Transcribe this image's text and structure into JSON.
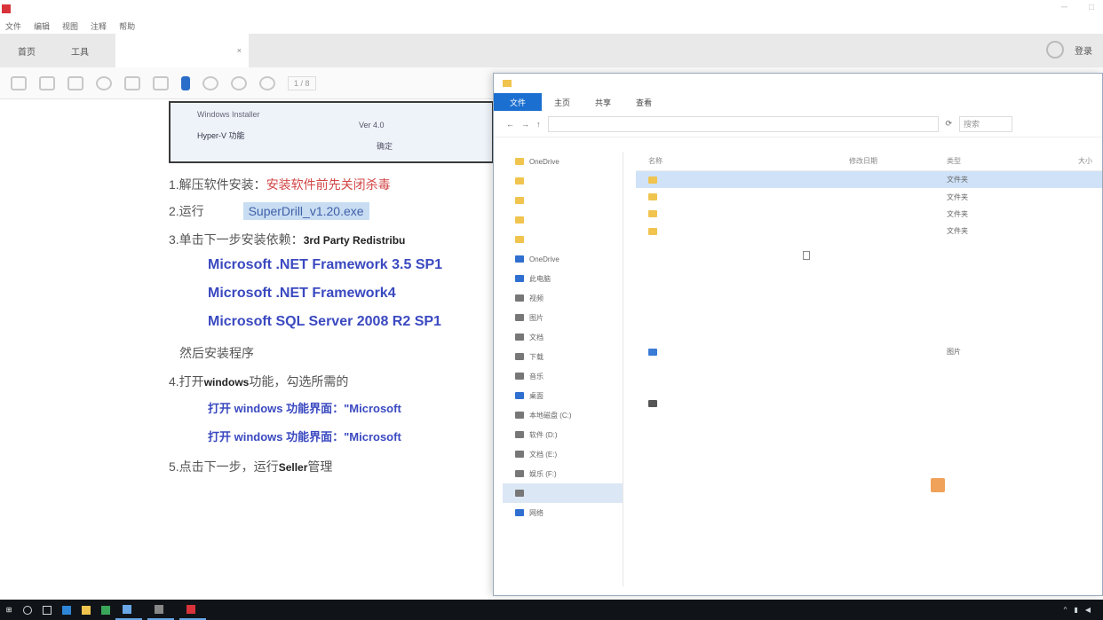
{
  "window": {
    "title": "",
    "menu": [
      "文件",
      "编辑",
      "视图",
      "注释",
      "帮助"
    ],
    "controls": [
      "─",
      "□"
    ]
  },
  "tabs": {
    "home": "首页",
    "tools": "工具",
    "document_tab": "",
    "close": "×",
    "login": "登录"
  },
  "toolbar": {
    "page_field": "1 / 8"
  },
  "document": {
    "screenshot": {
      "label1": "Windows Installer",
      "label2": "Hyper-V 功能",
      "value1": "Ver 4.0",
      "value2": "确定"
    },
    "line1_prefix": "1.解压软件安装：",
    "line1_red": "安装软件前先关闭杀毒",
    "line2_prefix": "2.运行",
    "line2_highlight": "SuperDrill_v1.20.exe",
    "line3_prefix": "3.单击下一步安装依赖：",
    "line3_black": "3rd Party Redistribu",
    "link1": "Microsoft .NET Framework 3.5 SP1",
    "link2": "Microsoft .NET Framework4",
    "link3": "Microsoft SQL Server 2008 R2 SP1",
    "line4": "然后安装程序",
    "line5_prefix": "4.打开",
    "line5_black": "windows",
    "line5_suffix": "功能，勾选所需的",
    "link4": "打开 windows 功能界面：\"Microsoft",
    "link5": "打开 windows 功能界面：\"Microsoft",
    "line6_prefix": "5.点击下一步，运行",
    "line6_black": "Seller",
    "line6_suffix": "管理"
  },
  "explorer": {
    "title": "",
    "ribbon": {
      "file": "文件",
      "tabs": [
        "主页",
        "共享",
        "查看"
      ]
    },
    "address": "",
    "search_placeholder": "搜索",
    "nav": [
      {
        "label": "OneDrive",
        "icon": "folder"
      },
      {
        "label": "",
        "icon": "folder"
      },
      {
        "label": "",
        "icon": "folder"
      },
      {
        "label": "",
        "icon": "folder"
      },
      {
        "label": "",
        "icon": "folder"
      },
      {
        "label": "OneDrive",
        "icon": "cloud"
      },
      {
        "label": "此电脑",
        "icon": "pc"
      },
      {
        "label": "视频",
        "icon": "folder"
      },
      {
        "label": "图片",
        "icon": "folder"
      },
      {
        "label": "文档",
        "icon": "folder"
      },
      {
        "label": "下载",
        "icon": "folder"
      },
      {
        "label": "音乐",
        "icon": "folder"
      },
      {
        "label": "桌面",
        "icon": "folder"
      },
      {
        "label": "本地磁盘 (C:)",
        "icon": "drive"
      },
      {
        "label": "软件 (D:)",
        "icon": "drive"
      },
      {
        "label": "文档 (E:)",
        "icon": "drive"
      },
      {
        "label": "娱乐 (F:)",
        "icon": "drive"
      },
      {
        "label": "",
        "icon": "drive"
      },
      {
        "label": "网络",
        "icon": "network"
      }
    ],
    "columns": [
      "名称",
      "修改日期",
      "类型",
      "大小"
    ],
    "files": [
      {
        "name": "",
        "date": "",
        "type": "文件夹",
        "size": "",
        "icon": "folder"
      },
      {
        "name": "",
        "date": "",
        "type": "文件夹",
        "size": "",
        "icon": "folder"
      },
      {
        "name": "",
        "date": "",
        "type": "文件夹",
        "size": "",
        "icon": "folder"
      },
      {
        "name": "",
        "date": "",
        "type": "文件夹",
        "size": "",
        "icon": "folder"
      },
      {
        "name": "",
        "date": "",
        "type": "",
        "size": "",
        "icon": "doc"
      },
      {
        "name": "",
        "date": "",
        "type": "",
        "size": "",
        "icon": "doc"
      },
      {
        "name": "",
        "date": "",
        "type": "",
        "size": "",
        "icon": "doc"
      },
      {
        "name": "",
        "date": "",
        "type": "",
        "size": "",
        "icon": "doc"
      },
      {
        "name": "",
        "date": "",
        "type": "",
        "size": "",
        "icon": "doc"
      },
      {
        "name": "",
        "date": "",
        "type": "",
        "size": "",
        "icon": "doc"
      },
      {
        "name": "",
        "date": "",
        "type": "图片",
        "size": "",
        "icon": "setup"
      },
      {
        "name": "",
        "date": "",
        "type": "",
        "size": "",
        "icon": "doc"
      },
      {
        "name": "",
        "date": "",
        "type": "",
        "size": "",
        "icon": "doc"
      },
      {
        "name": "",
        "date": "",
        "type": "",
        "size": "",
        "icon": "app"
      }
    ],
    "status": {
      "count": "",
      "selected": ""
    },
    "watermark": ""
  },
  "taskbar": {
    "apps": [
      "",
      "",
      ""
    ],
    "clock": ""
  },
  "colors": {
    "accent": "#1b6fd0",
    "red_text": "#d24545",
    "link": "#3a49c0",
    "taskbar": "#101418"
  }
}
